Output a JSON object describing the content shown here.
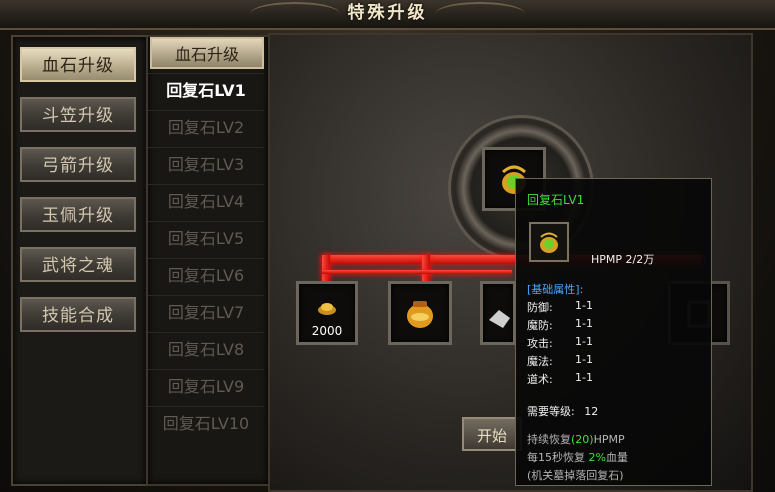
{
  "window": {
    "title": "特殊升级"
  },
  "categories": [
    {
      "label": "血石升级",
      "active": true
    },
    {
      "label": "斗笠升级",
      "active": false
    },
    {
      "label": "弓箭升级",
      "active": false
    },
    {
      "label": "玉佩升级",
      "active": false
    },
    {
      "label": "武将之魂",
      "active": false
    },
    {
      "label": "技能合成",
      "active": false
    }
  ],
  "levels": {
    "header": "血石升级",
    "items": [
      {
        "label": "回复石LV1",
        "selected": true
      },
      {
        "label": "回复石LV2",
        "selected": false
      },
      {
        "label": "回复石LV3",
        "selected": false
      },
      {
        "label": "回复石LV4",
        "selected": false
      },
      {
        "label": "回复石LV5",
        "selected": false
      },
      {
        "label": "回复石LV6",
        "selected": false
      },
      {
        "label": "回复石LV7",
        "selected": false
      },
      {
        "label": "回复石LV8",
        "selected": false
      },
      {
        "label": "回复石LV9",
        "selected": false
      },
      {
        "label": "回复石LV10",
        "selected": false
      }
    ]
  },
  "main": {
    "material_count": "2000",
    "start_button": "开始"
  },
  "tooltip": {
    "name": "回复石LV1",
    "hpmp": "HPMP 2/2万",
    "section_title": "[基础属性]:",
    "stats": [
      {
        "label": "防御:",
        "value": "1-1"
      },
      {
        "label": "魔防:",
        "value": "1-1"
      },
      {
        "label": "攻击:",
        "value": "1-1"
      },
      {
        "label": "魔法:",
        "value": "1-1"
      },
      {
        "label": "道术:",
        "value": "1-1"
      }
    ],
    "req_label": "需要等级:",
    "req_value": "12",
    "effect1_pre": "持续恢复",
    "effect1_val": "(20)",
    "effect1_post": "HPMP",
    "effect2_pre": "每15秒恢复",
    "effect2_val": "2%",
    "effect2_post": "血量",
    "effect3": "(机关墓掉落回复石)"
  },
  "colors": {
    "accent_green": "#3ee03e",
    "accent_blue": "#4aa8ff",
    "glow_red": "#ff2a1a"
  }
}
